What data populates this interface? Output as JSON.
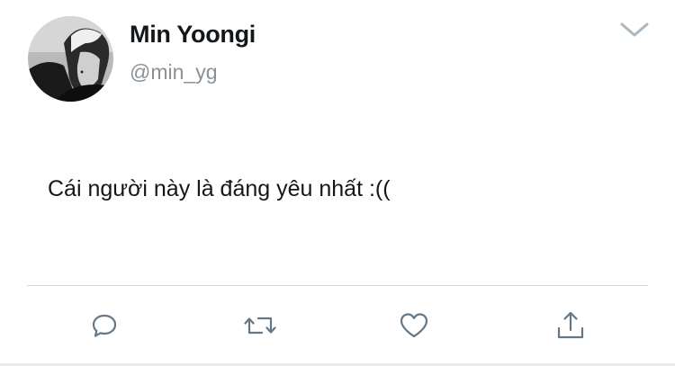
{
  "tweet": {
    "author": {
      "display_name": "Min Yoongi",
      "handle": "@min_yg"
    },
    "text": "Cái người này là đáng yêu nhất :(("
  },
  "icons": {
    "menu": "chevron-down-icon",
    "reply": "reply-icon",
    "retweet": "retweet-icon",
    "like": "heart-icon",
    "share": "share-icon"
  },
  "colors": {
    "text": "#14171a",
    "secondary_text": "#8a9197",
    "icon": "#657786",
    "divider": "#d3d7da"
  }
}
